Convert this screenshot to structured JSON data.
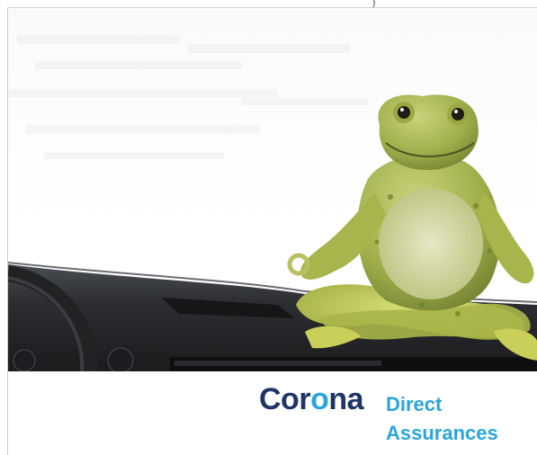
{
  "ad": {
    "brand": {
      "name_part1": "Cor",
      "name_accent": "o",
      "name_part2": "na",
      "line2": "Direct",
      "line3": "Assurances",
      "colors": {
        "primary_navy": "#1f3566",
        "accent_blue": "#2aa6dc"
      }
    },
    "top_mark": ")",
    "scene": {
      "subject": "frog-meditating-on-dashboard"
    }
  }
}
